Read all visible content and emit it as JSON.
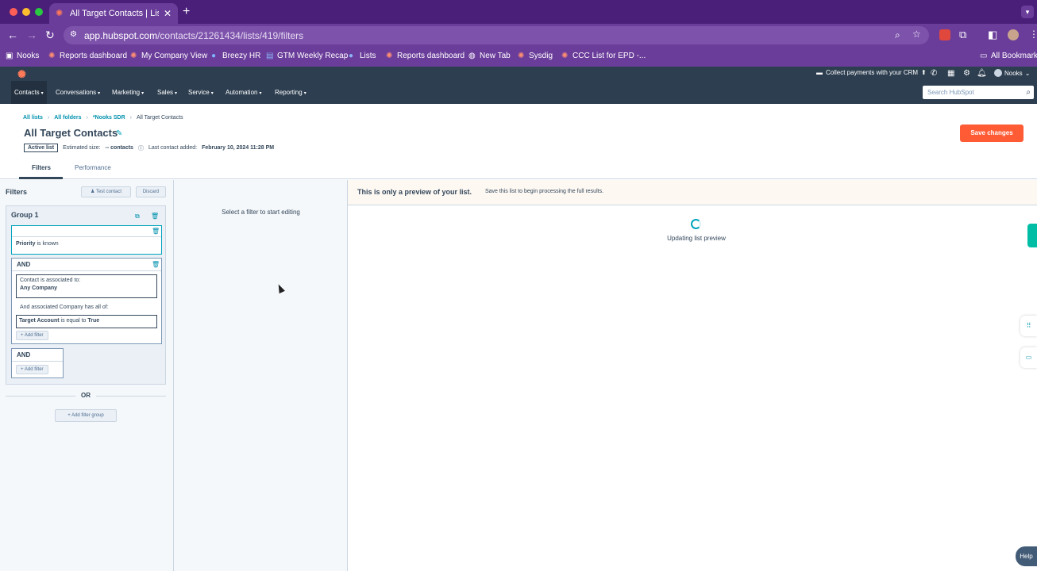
{
  "browser": {
    "tab_title": "All Target Contacts | Lists",
    "url_host": "app.hubspot.com",
    "url_path": "/contacts/21261434/lists/419/filters",
    "colors": {
      "frame": "#4a1f7a",
      "toolbar": "#6a3d9a"
    },
    "bookmarks": [
      {
        "label": "Nooks",
        "icon": "nooks-icon"
      },
      {
        "label": "Reports dashboard",
        "icon": "hubspot-icon"
      },
      {
        "label": "My Company View",
        "icon": "hubspot-icon"
      },
      {
        "label": "Breezy HR",
        "icon": "breezy-icon"
      },
      {
        "label": "GTM Weekly Recap",
        "icon": "doc-icon"
      },
      {
        "label": "Lists",
        "icon": "lists-icon"
      },
      {
        "label": "Reports dashboard",
        "icon": "hubspot-icon"
      },
      {
        "label": "New Tab",
        "icon": "globe-icon"
      },
      {
        "label": "Sysdig",
        "icon": "hubspot-icon"
      },
      {
        "label": "CCC List for EPD -...",
        "icon": "hubspot-icon"
      }
    ],
    "all_bookmarks": "All Bookmarks"
  },
  "hubspot": {
    "collect_payments": "Collect payments with your CRM",
    "account": "Nooks",
    "nav": [
      "Contacts",
      "Conversations",
      "Marketing",
      "Sales",
      "Service",
      "Automation",
      "Reporting"
    ],
    "search_placeholder": "Search HubSpot",
    "accent": "#ff7a59"
  },
  "header": {
    "breadcrumb": [
      "All lists",
      "All folders",
      "*Nooks SDR",
      "All Target Contacts"
    ],
    "title": "All Target Contacts",
    "badge": "Active list",
    "estimated_label": "Estimated size:",
    "estimated_value": "-- contacts",
    "last_added_label": "Last contact added:",
    "last_added_value": "February 10, 2024 11:28 PM",
    "save_button": "Save changes"
  },
  "tabs": [
    "Filters",
    "Performance"
  ],
  "filters": {
    "title": "Filters",
    "test_contact": "Test contact",
    "discard": "Discard",
    "group_title": "Group 1",
    "priority_prop": "Priority",
    "priority_op": "is known",
    "and_label": "AND",
    "assoc_line1": "Contact is associated to:",
    "assoc_line2": "Any Company",
    "assoc_sub": "And associated Company has all of:",
    "target_prop": "Target Account",
    "target_op": "is equal to",
    "target_val": "True",
    "add_filter": "Add filter",
    "or_label": "OR",
    "add_filter_group": "Add filter group"
  },
  "middle": {
    "hint": "Select a filter to start editing"
  },
  "preview": {
    "banner_strong": "This is only a preview of your list.",
    "banner_note": "Save this list to begin processing the full results.",
    "updating": "Updating list preview"
  },
  "help": "Help"
}
